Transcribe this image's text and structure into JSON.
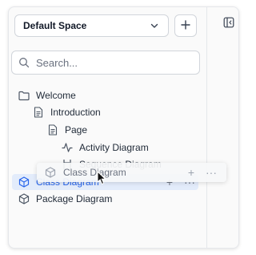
{
  "space_selector": {
    "value": "Default Space",
    "icon": "chevron-down-icon"
  },
  "add_space": {
    "label": "+"
  },
  "search": {
    "placeholder": "Search..."
  },
  "tree": [
    {
      "label": "Welcome",
      "icon": "folder-icon"
    },
    {
      "label": "Introduction",
      "icon": "document-icon"
    },
    {
      "label": "Page",
      "icon": "document-icon"
    },
    {
      "label": "Activity Diagram",
      "icon": "activity-icon"
    },
    {
      "label": "Sequence Diagram",
      "icon": "sequence-icon"
    },
    {
      "label": "Class Diagram",
      "icon": "cube-icon",
      "selected": true
    },
    {
      "label": "Package Diagram",
      "icon": "cube-icon"
    }
  ],
  "row_actions": {
    "add": "+",
    "more": "···"
  },
  "drag_ghost": {
    "label": "Class Diagram"
  },
  "colors": {
    "accent": "#2563eb",
    "selected_bg": "#e3ecfb"
  }
}
